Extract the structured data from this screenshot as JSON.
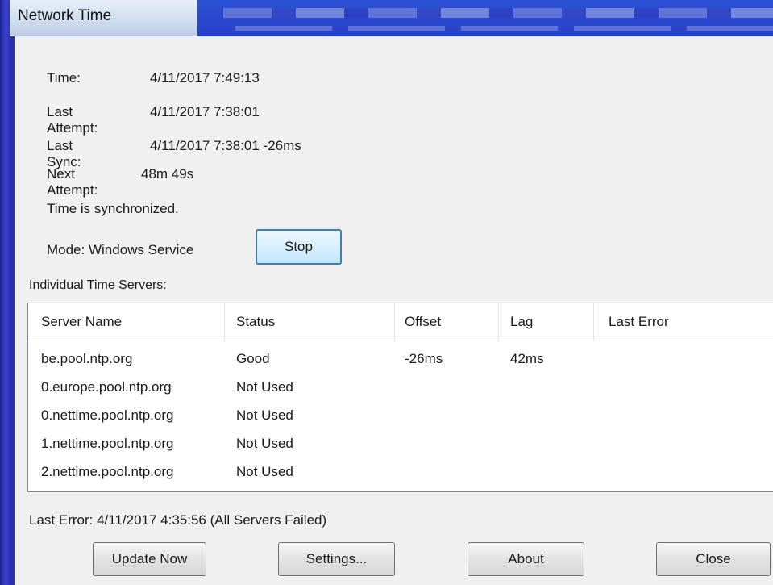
{
  "window": {
    "title": "Network Time"
  },
  "info": {
    "time_label": "Time:",
    "time_value": "4/11/2017 7:49:13",
    "last_attempt_label": "Last Attempt:",
    "last_attempt_value": "4/11/2017 7:38:01",
    "last_sync_label": "Last Sync:",
    "last_sync_value": "4/11/2017 7:38:01 -26ms",
    "next_attempt_label": "Next Attempt:",
    "next_attempt_value": "48m 49s",
    "status_text": "Time is synchronized.",
    "mode_text": "Mode: Windows Service",
    "stop_label": "Stop"
  },
  "servers": {
    "section_label": "Individual Time Servers:",
    "columns": [
      "Server Name",
      "Status",
      "Offset",
      "Lag",
      "Last Error"
    ],
    "rows": [
      {
        "name": "be.pool.ntp.org",
        "status": "Good",
        "offset": "-26ms",
        "lag": "42ms",
        "error": ""
      },
      {
        "name": "0.europe.pool.ntp.org",
        "status": "Not Used",
        "offset": "",
        "lag": "",
        "error": ""
      },
      {
        "name": "0.nettime.pool.ntp.org",
        "status": "Not Used",
        "offset": "",
        "lag": "",
        "error": ""
      },
      {
        "name": "1.nettime.pool.ntp.org",
        "status": "Not Used",
        "offset": "",
        "lag": "",
        "error": ""
      },
      {
        "name": "2.nettime.pool.ntp.org",
        "status": "Not Used",
        "offset": "",
        "lag": "",
        "error": ""
      }
    ]
  },
  "footer": {
    "last_error": "Last Error:  4/11/2017 4:35:56 (All Servers Failed)",
    "update_now_label": "Update Now",
    "settings_label": "Settings...",
    "about_label": "About",
    "close_label": "Close"
  },
  "colors": {
    "desktop": "#2a2fb8",
    "dialog_bg": "#f0f0f0",
    "focus_border": "#3c7fb1"
  }
}
